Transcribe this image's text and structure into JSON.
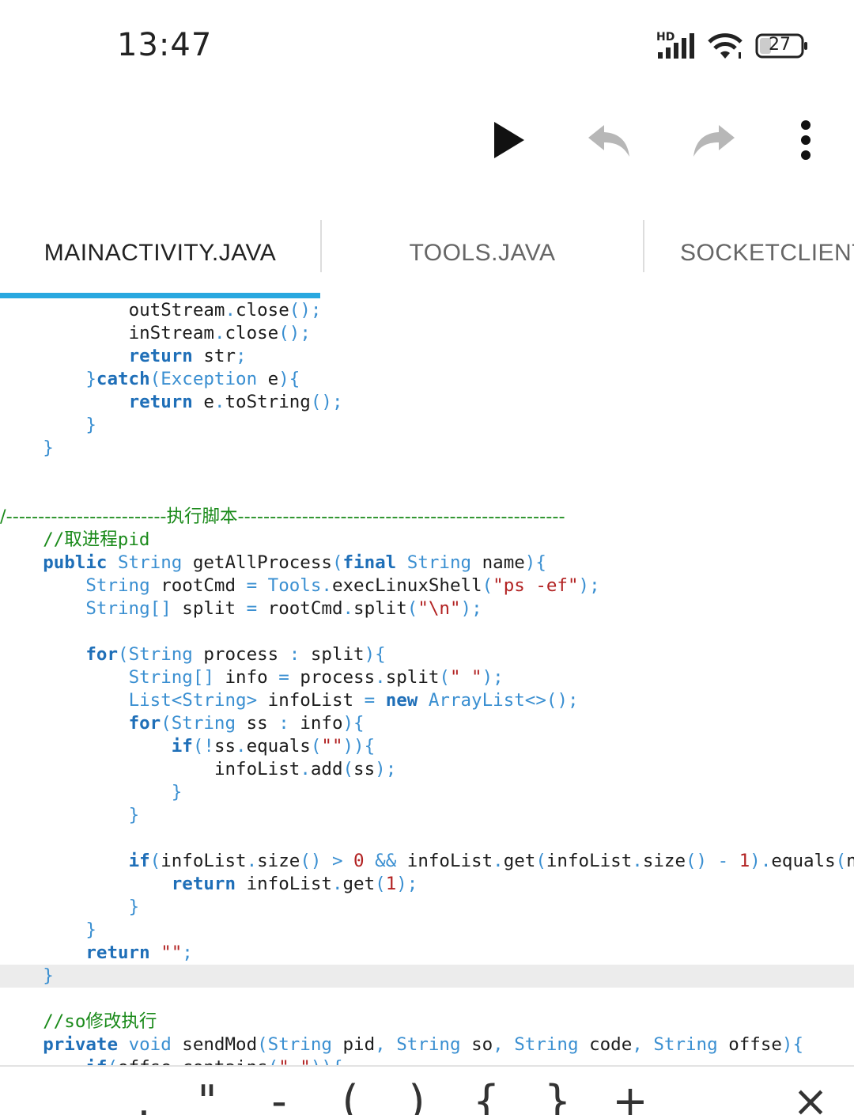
{
  "status_bar": {
    "time": "13:47",
    "network_label": "HD",
    "battery": "27"
  },
  "toolbar": {
    "run_icon": "play-icon",
    "undo_icon": "undo-icon",
    "redo_icon": "redo-icon",
    "more_icon": "more-vert-icon"
  },
  "tabs": [
    {
      "label": "MAINACTIVITY.JAVA",
      "active": true
    },
    {
      "label": "TOOLS.JAVA",
      "active": false
    },
    {
      "label": "SOCKETCLIENT",
      "active": false
    }
  ],
  "accent_color": "#29a8e0",
  "code": {
    "lines": [
      "            outStream.close();",
      "            inStream.close();",
      "            return str;",
      "        }catch(Exception e){",
      "            return e.toString();",
      "        }",
      "    }",
      "",
      "",
      "/-------------------------执行脚本---------------------------------------------------",
      "    //取进程pid",
      "    public String getAllProcess(final String name){",
      "        String rootCmd = Tools.execLinuxShell(\"ps -ef\");",
      "        String[] split = rootCmd.split(\"\\n\");",
      "",
      "        for(String process : split){",
      "            String[] info = process.split(\" \");",
      "            List<String> infoList = new ArrayList<>();",
      "            for(String ss : info){",
      "                if(!ss.equals(\"\")){",
      "                    infoList.add(ss);",
      "                }",
      "            }",
      "",
      "            if(infoList.size() > 0 && infoList.get(infoList.size() - 1).equals(name)",
      "                return infoList.get(1);",
      "            }",
      "        }",
      "        return \"\";",
      "    }",
      "",
      "    //so修改执行",
      "    private void sendMod(String pid, String so, String code, String offse){",
      "        if(offse.contains(\" \")){"
    ],
    "highlighted_line": 29
  },
  "keyboard_bar": {
    "keys": [
      ".",
      "\"",
      "-",
      "(",
      ")",
      "{",
      "}",
      "+",
      "_",
      "×"
    ]
  }
}
